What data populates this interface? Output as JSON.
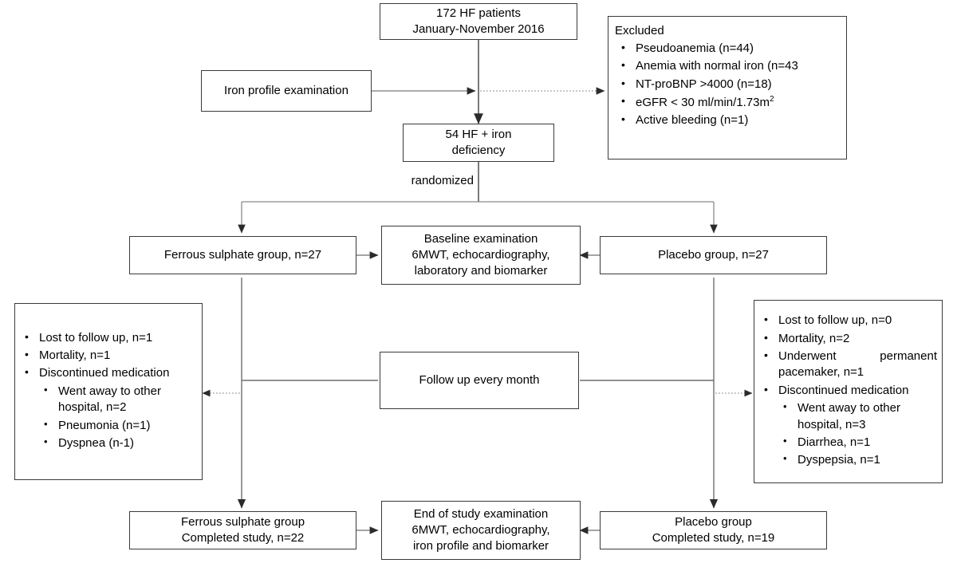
{
  "diagram": {
    "title": "CONSORT-style participant flow diagram",
    "style": {
      "box_border": "#3a3a3a",
      "connector_solid": "#595959",
      "connector_dotted": "#9a9a9a",
      "background": "#ffffff"
    }
  },
  "nodes": {
    "enrollment": {
      "line1": "172 HF patients",
      "line2": "January-November 2016"
    },
    "iron_profile": {
      "line1": "Iron profile examination"
    },
    "excluded": {
      "heading": "Excluded",
      "items": [
        "Pseudoanemia (n=44)",
        "Anemia with normal iron (n=43",
        "NT-proBNP >4000 (n=18)",
        "eGFR < 30 ml/min/1.73m",
        "Active bleeding (n=1)"
      ],
      "egfr_superscript": "2"
    },
    "eligible": {
      "line1": "54 HF + iron",
      "line2": "deficiency"
    },
    "randomized_label": "randomized",
    "ferrous_group": {
      "line1": "Ferrous sulphate group, n=27"
    },
    "placebo_group": {
      "line1": "Placebo group, n=27"
    },
    "baseline_exam": {
      "line1": "Baseline examination",
      "line2": "6MWT, echocardiography,",
      "line3": "laboratory and biomarker"
    },
    "followup": {
      "line1": "Follow up every month"
    },
    "ferrous_dropouts": {
      "items": [
        "Lost to follow up, n=1",
        "Mortality, n=1",
        "Discontinued medication"
      ],
      "sub_items": [
        "Went away to other hospital, n=2",
        "Pneumonia (n=1)",
        "Dyspnea (n-1)"
      ]
    },
    "placebo_dropouts": {
      "items": [
        "Lost to follow up, n=0",
        "Mortality, n=2",
        "Underwent permanent pacemaker, n=1",
        "Discontinued medication"
      ],
      "sub_items": [
        "Went away to other hospital, n=3",
        "Diarrhea, n=1",
        "Dyspepsia, n=1"
      ]
    },
    "ferrous_completed": {
      "line1": "Ferrous sulphate group",
      "line2": "Completed study, n=22"
    },
    "placebo_completed": {
      "line1": "Placebo group",
      "line2": "Completed study, n=19"
    },
    "end_exam": {
      "line1": "End of study examination",
      "line2": "6MWT, echocardiography,",
      "line3": "iron profile and biomarker"
    }
  }
}
